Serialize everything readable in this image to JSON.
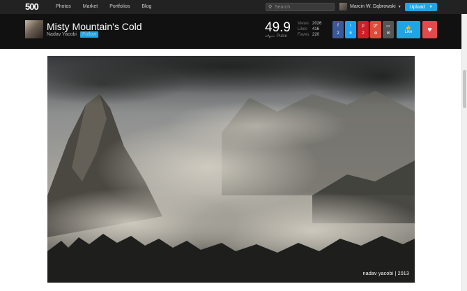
{
  "topbar": {
    "logo": "500",
    "nav": [
      "Photos",
      "Market",
      "Portfolios",
      "Blog"
    ],
    "search_placeholder": "Search",
    "user_name": "Marcin W. Dąbrowski",
    "upload_label": "Upload"
  },
  "photo": {
    "title": "Misty Mountain's Cold",
    "author": "Nadav Yacobi",
    "follow_label": "Follow",
    "pulse": "49.9",
    "pulse_label": "Pulse",
    "stats": [
      {
        "label": "Views",
        "value": "2026"
      },
      {
        "label": "Likes",
        "value": "416"
      },
      {
        "label": "Faves",
        "value": "220"
      }
    ],
    "shares": [
      {
        "icon": "facebook-icon",
        "glyph": "f",
        "count": "2",
        "color": "#3b5998"
      },
      {
        "icon": "twitter-icon",
        "glyph": "t",
        "count": "6",
        "color": "#1da1f2"
      },
      {
        "icon": "pinterest-icon",
        "glyph": "p",
        "count": "2",
        "color": "#cb2027"
      },
      {
        "icon": "googleplus-icon",
        "glyph": "g+",
        "count": "",
        "color": "#dd4b39"
      },
      {
        "icon": "embed-icon",
        "glyph": "▭",
        "count": "",
        "color": "#555555"
      }
    ],
    "like_label": "Like",
    "watermark": "nadav yacobi  |  2013"
  }
}
